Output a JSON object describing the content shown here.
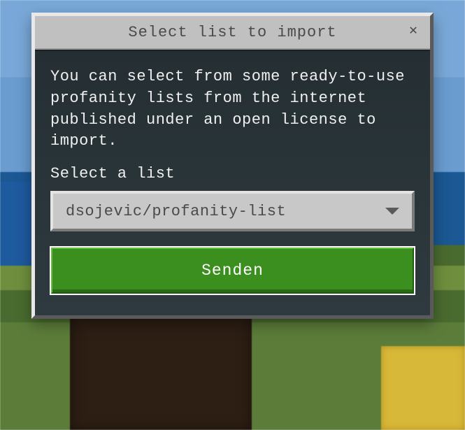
{
  "dialog": {
    "title": "Select list to import",
    "close_icon": "✕",
    "description": "You can select from some ready-to-use profanity lists from the internet published under an open license to import.",
    "select_label": "Select a list",
    "dropdown": {
      "selected": "dsojevic/profanity-list"
    },
    "submit_label": "Senden"
  },
  "colors": {
    "dialog_bg": "#c0c0c0",
    "body_bg": "#2a3438",
    "accent_green": "#3a8f1f",
    "text_light": "#f0f0f0",
    "text_dark": "#4a4a4a"
  }
}
